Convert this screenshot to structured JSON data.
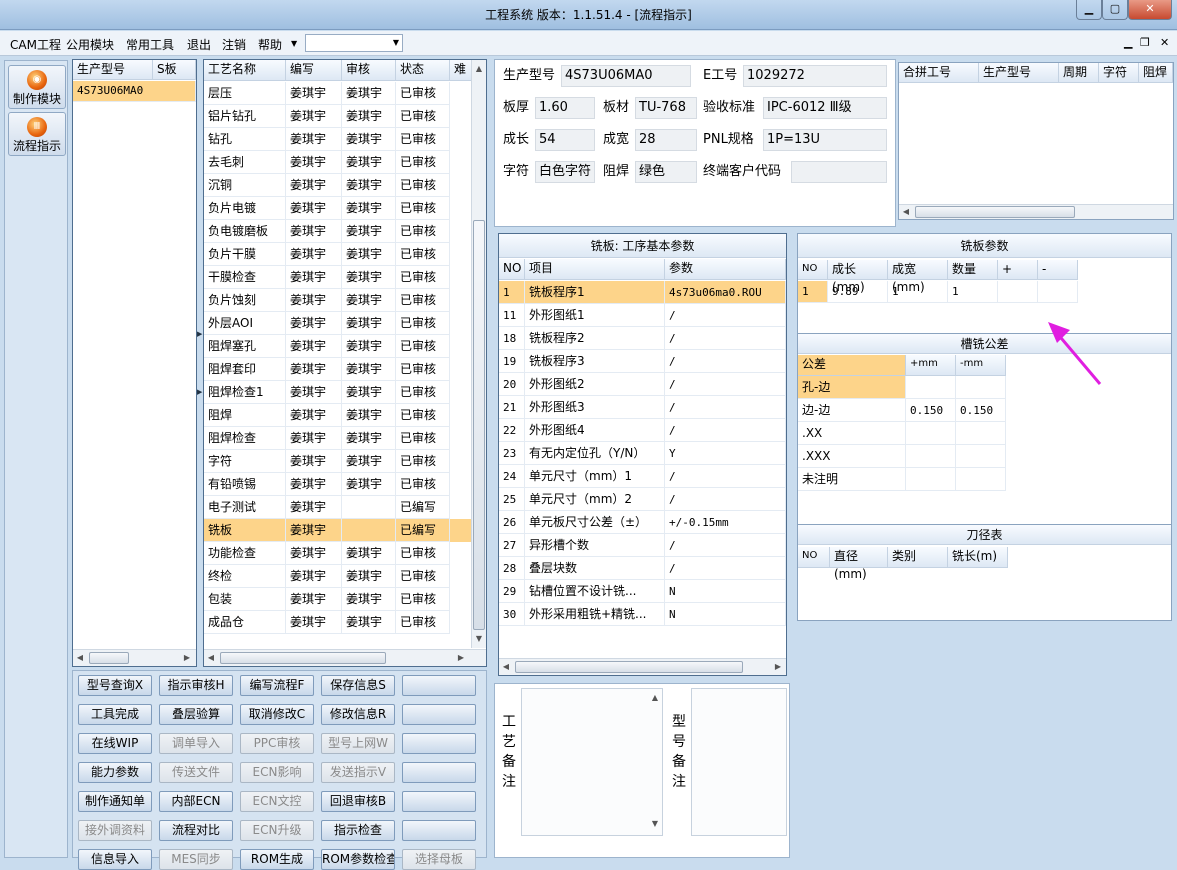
{
  "window": {
    "title": "工程系统   版本：1.1.51.4 - [流程指示]"
  },
  "menu": {
    "items": [
      "CAM工程",
      "公用模块",
      "常用工具",
      "退出",
      "注销",
      "帮助"
    ],
    "combo_value": ""
  },
  "nav": {
    "items": [
      "制作模块",
      "流程指示"
    ]
  },
  "model_list": {
    "headers": [
      "生产型号",
      "S板"
    ],
    "rows": [
      [
        "4S73U06MA0",
        ""
      ]
    ]
  },
  "process": {
    "headers": [
      "工艺名称",
      "编写",
      "审核",
      "状态",
      "难"
    ],
    "rows": [
      [
        "层压",
        "姜琪宇",
        "姜琪宇",
        "已审核"
      ],
      [
        "铝片钻孔",
        "姜琪宇",
        "姜琪宇",
        "已审核"
      ],
      [
        "钻孔",
        "姜琪宇",
        "姜琪宇",
        "已审核"
      ],
      [
        "去毛刺",
        "姜琪宇",
        "姜琪宇",
        "已审核"
      ],
      [
        "沉铜",
        "姜琪宇",
        "姜琪宇",
        "已审核"
      ],
      [
        "负片电镀",
        "姜琪宇",
        "姜琪宇",
        "已审核"
      ],
      [
        "负电镀磨板",
        "姜琪宇",
        "姜琪宇",
        "已审核"
      ],
      [
        "负片干膜",
        "姜琪宇",
        "姜琪宇",
        "已审核"
      ],
      [
        "干膜检查",
        "姜琪宇",
        "姜琪宇",
        "已审核"
      ],
      [
        "负片蚀刻",
        "姜琪宇",
        "姜琪宇",
        "已审核"
      ],
      [
        "外层AOI",
        "姜琪宇",
        "姜琪宇",
        "已审核"
      ],
      [
        "阻焊塞孔",
        "姜琪宇",
        "姜琪宇",
        "已审核"
      ],
      [
        "阻焊套印",
        "姜琪宇",
        "姜琪宇",
        "已审核"
      ],
      [
        "阻焊检查1",
        "姜琪宇",
        "姜琪宇",
        "已审核"
      ],
      [
        "阻焊",
        "姜琪宇",
        "姜琪宇",
        "已审核"
      ],
      [
        "阻焊检查",
        "姜琪宇",
        "姜琪宇",
        "已审核"
      ],
      [
        "字符",
        "姜琪宇",
        "姜琪宇",
        "已审核"
      ],
      [
        "有铅喷锡",
        "姜琪宇",
        "姜琪宇",
        "已审核"
      ],
      [
        "电子测试",
        "姜琪宇",
        "",
        "已编写"
      ],
      [
        "铣板",
        "姜琪宇",
        "",
        "已编写"
      ],
      [
        "功能检查",
        "姜琪宇",
        "姜琪宇",
        "已审核"
      ],
      [
        "终检",
        "姜琪宇",
        "姜琪宇",
        "已审核"
      ],
      [
        "包装",
        "姜琪宇",
        "姜琪宇",
        "已审核"
      ],
      [
        "成品仓",
        "姜琪宇",
        "姜琪宇",
        "已审核"
      ]
    ],
    "selected_index": 19
  },
  "info": {
    "model_label": "生产型号",
    "model_value": "4S73U06MA0",
    "e_label": "E工号",
    "e_value": "1029272",
    "thick_label": "板厚",
    "thick_value": "1.60",
    "mat_label": "板材",
    "mat_value": "TU-768",
    "std_label": "验收标准",
    "std_value": "IPC-6012 Ⅲ级",
    "len_label": "成长",
    "len_value": "54",
    "wid_label": "成宽",
    "wid_value": "28",
    "pnl_label": "PNL规格",
    "pnl_value": "1P=13U",
    "char_label": "字符",
    "char_value": "白色字符",
    "mask_label": "阻焊",
    "mask_value": "绿色",
    "cust_label": "终端客户代码",
    "cust_value": ""
  },
  "merge": {
    "headers": [
      "合拼工号",
      "生产型号",
      "周期",
      "字符",
      "阻焊"
    ]
  },
  "params": {
    "title": "铣板: 工序基本参数",
    "headers": [
      "NO",
      "项目",
      "参数"
    ],
    "rows": [
      [
        "1",
        "铣板程序1",
        "4s73u06ma0.ROU"
      ],
      [
        "11",
        "外形图纸1",
        "/"
      ],
      [
        "18",
        "铣板程序2",
        "/"
      ],
      [
        "19",
        "铣板程序3",
        "/"
      ],
      [
        "20",
        "外形图纸2",
        "/"
      ],
      [
        "21",
        "外形图纸3",
        "/"
      ],
      [
        "22",
        "外形图纸4",
        "/"
      ],
      [
        "23",
        "有无内定位孔（Y/N）",
        "Y"
      ],
      [
        "24",
        "单元尺寸（mm）1",
        "/"
      ],
      [
        "25",
        "单元尺寸（mm）2",
        "/"
      ],
      [
        "26",
        "单元板尺寸公差（±）",
        "+/-0.15mm"
      ],
      [
        "27",
        "异形槽个数",
        "/"
      ],
      [
        "28",
        "叠层块数",
        "/"
      ],
      [
        "29",
        "钻槽位置不设计铣...",
        "N"
      ],
      [
        "30",
        "外形采用粗铣+精铣...",
        "N"
      ]
    ]
  },
  "mill": {
    "title": "铣板参数",
    "headers": [
      "NO",
      "成长(mm)",
      "成宽(mm)",
      "数量",
      "+",
      "-"
    ],
    "rows": [
      [
        "1",
        "9.89",
        "1",
        "1",
        "",
        ""
      ]
    ]
  },
  "slot": {
    "title": "槽铣公差",
    "headers": [
      "公差",
      "+mm",
      "-mm"
    ],
    "rows": [
      [
        "孔-边",
        "",
        ""
      ],
      [
        "边-边",
        "0.150",
        "0.150"
      ],
      [
        ".XX",
        "",
        ""
      ],
      [
        ".XXX",
        "",
        ""
      ],
      [
        "未注明",
        "",
        ""
      ]
    ]
  },
  "tool": {
    "title": "刀径表",
    "headers": [
      "NO",
      "直径(mm)",
      "类别",
      "铣长(m)"
    ]
  },
  "buttons": [
    {
      "label": "型号查询X",
      "enabled": true
    },
    {
      "label": "指示审核H",
      "enabled": true
    },
    {
      "label": "编写流程F",
      "enabled": true
    },
    {
      "label": "保存信息S",
      "enabled": true
    },
    {
      "label": "",
      "enabled": true
    },
    {
      "label": "工具完成",
      "enabled": true
    },
    {
      "label": "叠层验算",
      "enabled": true
    },
    {
      "label": "取消修改C",
      "enabled": true
    },
    {
      "label": "修改信息R",
      "enabled": true
    },
    {
      "label": "",
      "enabled": true
    },
    {
      "label": "在线WIP",
      "enabled": true
    },
    {
      "label": "调单导入",
      "enabled": false
    },
    {
      "label": "PPC审核",
      "enabled": false
    },
    {
      "label": "型号上网W",
      "enabled": false
    },
    {
      "label": "",
      "enabled": true
    },
    {
      "label": "能力参数",
      "enabled": true
    },
    {
      "label": "传送文件",
      "enabled": false
    },
    {
      "label": "ECN影响",
      "enabled": false
    },
    {
      "label": "发送指示V",
      "enabled": false
    },
    {
      "label": "",
      "enabled": true
    },
    {
      "label": "制作通知单",
      "enabled": true
    },
    {
      "label": "内部ECN",
      "enabled": true
    },
    {
      "label": "ECN文控",
      "enabled": false
    },
    {
      "label": "回退审核B",
      "enabled": true
    },
    {
      "label": "",
      "enabled": true
    },
    {
      "label": "接外调资料",
      "enabled": false
    },
    {
      "label": "流程对比",
      "enabled": true
    },
    {
      "label": "ECN升级",
      "enabled": false
    },
    {
      "label": "指示检查",
      "enabled": true
    },
    {
      "label": "",
      "enabled": true
    },
    {
      "label": "信息导入",
      "enabled": true
    },
    {
      "label": "MES同步",
      "enabled": false
    },
    {
      "label": "ROM生成",
      "enabled": true
    },
    {
      "label": "ROM参数检查",
      "enabled": true
    },
    {
      "label": "选择母板",
      "enabled": false
    }
  ],
  "notes": {
    "process_label": "工艺备注",
    "model_label": "型号备注"
  },
  "colors": {
    "selection": "#fdd48a",
    "annotation_arrow": "#e01ee0",
    "frame": "#c9dcee"
  }
}
